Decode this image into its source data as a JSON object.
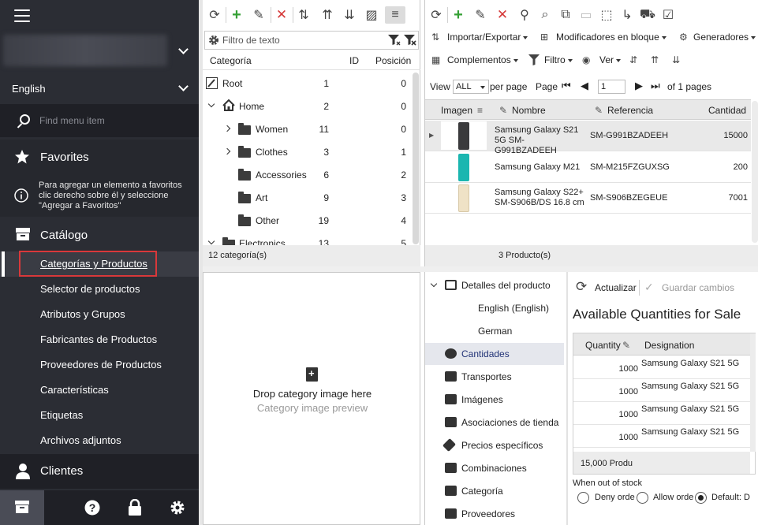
{
  "sidebar": {
    "language": "English",
    "search_placeholder": "Find menu item",
    "favorites_title": "Favorites",
    "favorites_note": "Para agregar un elemento a favoritos clic derecho sobre él y seleccione \"Agregar a Favoritos\"",
    "catalog_title": "Catálogo",
    "catalog_items": [
      "Categorías y Productos",
      "Selector de productos",
      "Atributos y Grupos",
      "Fabricantes de Productos",
      "Proveedores de Productos",
      "Características",
      "Etiquetas",
      "Archivos adjuntos"
    ],
    "clients_title": "Clientes"
  },
  "categories": {
    "filter_placeholder": "Filtro de texto",
    "columns": {
      "name": "Categoría",
      "id": "ID",
      "position": "Posición"
    },
    "rows": [
      {
        "name": "Root",
        "id": "1",
        "pos": "0"
      },
      {
        "name": "Home",
        "id": "2",
        "pos": "0"
      },
      {
        "name": "Women",
        "id": "11",
        "pos": "0"
      },
      {
        "name": "Clothes",
        "id": "3",
        "pos": "1"
      },
      {
        "name": "Accessories",
        "id": "6",
        "pos": "2"
      },
      {
        "name": "Art",
        "id": "9",
        "pos": "3"
      },
      {
        "name": "Other",
        "id": "19",
        "pos": "4"
      },
      {
        "name": "Electronics",
        "id": "13",
        "pos": "5"
      }
    ],
    "footer": "12 categoría(s)"
  },
  "category_image": {
    "drop_text": "Drop category image here",
    "preview_text": "Category image preview"
  },
  "products": {
    "menu": {
      "import_export": "Importar/Exportar",
      "bulk_modifiers": "Modificadores en bloque",
      "generators": "Generadores",
      "addons": "Complementos",
      "filter": "Filtro",
      "view": "Ver"
    },
    "pager": {
      "view_label": "View",
      "per_page_value": "ALL",
      "per_page_label": "per page",
      "page_label": "Page",
      "page_value": "1",
      "of_pages": "of 1 pages"
    },
    "columns": {
      "image": "Imagen",
      "name": "Nombre",
      "reference": "Referencia",
      "quantity": "Cantidad"
    },
    "rows": [
      {
        "name": "Samsung Galaxy S21 5G SM-G991BZADEEH",
        "reference": "SM-G991BZADEEH",
        "quantity": "15000",
        "color": "#3a3a3c"
      },
      {
        "name": "Samsung Galaxy M21",
        "reference": "SM-M215FZGUXSG",
        "quantity": "200",
        "color": "#1bb6b0"
      },
      {
        "name": "Samsung Galaxy S22+ SM-S906B/DS 16.8 cm",
        "reference": "SM-S906BZEGEUE",
        "quantity": "7001",
        "color": "#efe2c6"
      }
    ],
    "footer": "3 Producto(s)"
  },
  "details": {
    "root": "Detalles del producto",
    "langs": [
      "English (English)",
      "German"
    ],
    "items": [
      "Cantidades",
      "Transportes",
      "Imágenes",
      "Asociaciones de tienda",
      "Precios específicos",
      "Combinaciones",
      "Categoría",
      "Proveedores"
    ]
  },
  "quantities": {
    "refresh": "Actualizar",
    "save": "Guardar cambios",
    "heading": "Available Quantities for Sale",
    "columns": {
      "quantity": "Quantity",
      "designation": "Designation"
    },
    "rows": [
      {
        "q": "1000",
        "d": "Samsung Galaxy S21 5G"
      },
      {
        "q": "1000",
        "d": "Samsung Galaxy S21 5G"
      },
      {
        "q": "1000",
        "d": "Samsung Galaxy S21 5G"
      },
      {
        "q": "1000",
        "d": "Samsung Galaxy S21 5G"
      }
    ],
    "footer": "15,000 Produ",
    "oos_label": "When out of stock",
    "options": [
      "Deny orde",
      "Allow orde",
      "Default: D"
    ]
  }
}
